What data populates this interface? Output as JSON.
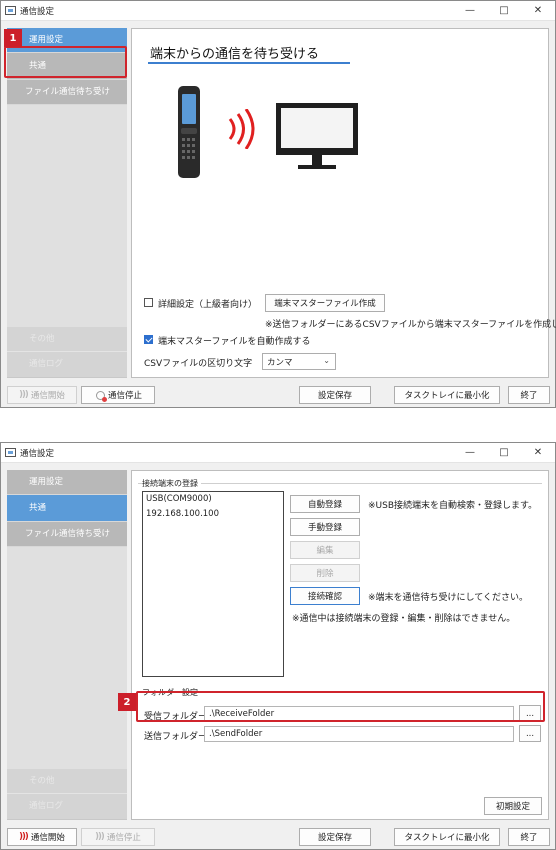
{
  "window1": {
    "title": "通信設定",
    "sidebar": {
      "items": [
        "運用設定",
        "共通",
        "ファイル通信待ち受け"
      ],
      "bottom_items": [
        "その他",
        "通信ログ"
      ]
    },
    "main": {
      "heading": "端末からの通信を待ち受ける",
      "advanced_checkbox": "詳細設定（上級者向け）",
      "master_button": "端末マスターファイル作成",
      "master_note": "※送信フォルダーにあるCSVファイルから端末マスターファイルを作成します",
      "auto_create_checkbox": "端末マスターファイルを自動作成する",
      "csv_delimiter_label": "CSVファイルの区切り文字",
      "csv_delimiter_value": "カンマ"
    },
    "footer": {
      "start": "通信開始",
      "stop": "通信停止",
      "save": "設定保存",
      "minimize": "タスクトレイに最小化",
      "exit": "終了"
    },
    "badge": "1"
  },
  "window2": {
    "title": "通信設定",
    "sidebar": {
      "items": [
        "運用設定",
        "共通",
        "ファイル通信待ち受け"
      ],
      "bottom_items": [
        "その他",
        "通信ログ"
      ]
    },
    "main": {
      "group_terminal": "接続端末の登録",
      "terminals": [
        "USB(COM9000)",
        "192.168.100.100"
      ],
      "auto_register": "自動登録",
      "auto_register_note": "※USB接続端末を自動検索・登録します。",
      "manual_register": "手動登録",
      "edit": "編集",
      "delete": "削除",
      "check_connection": "接続確認",
      "check_connection_note": "※端末を通信待ち受けにしてください。",
      "communicating_note": "※通信中は接続端末の登録・編集・削除はできません。",
      "group_folder": "フォルダー設定",
      "receive_folder_label": "受信フォルダー",
      "receive_folder_value": ".\\ReceiveFolder",
      "send_folder_label": "送信フォルダー",
      "send_folder_value": ".\\SendFolder",
      "browse": "...",
      "reset": "初期設定"
    },
    "footer": {
      "start": "通信開始",
      "stop": "通信停止",
      "save": "設定保存",
      "minimize": "タスクトレイに最小化",
      "exit": "終了"
    },
    "badge": "2"
  },
  "colors": {
    "active_tab": "#5b9bd8",
    "callout_red": "#d0242c",
    "signal_red": "#e02020"
  }
}
